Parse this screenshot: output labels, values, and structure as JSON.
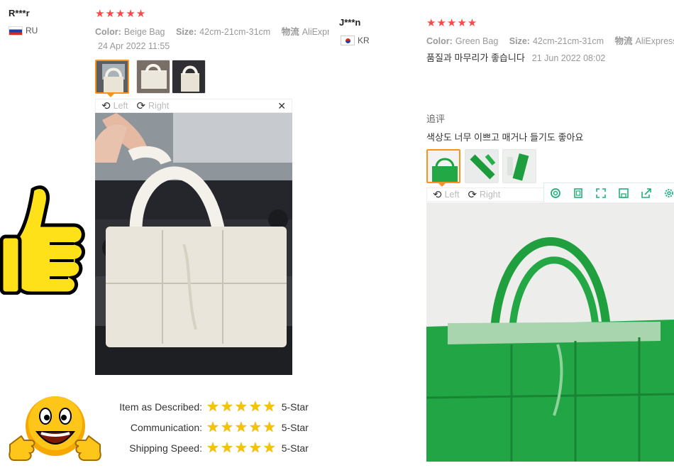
{
  "review1": {
    "user": "R***r",
    "country_code": "RU",
    "stars": "★★★★★",
    "color_label": "Color:",
    "color_value": "Beige Bag",
    "size_label": "Size:",
    "size_value": "42cm-21cm-31cm",
    "logistics_label": "物流",
    "logistics_value": "AliExpr",
    "date": "24 Apr 2022 11:55",
    "rotate_left": "Left",
    "rotate_right": "Right",
    "close": "✕"
  },
  "review2": {
    "user": "J***n",
    "country_code": "KR",
    "stars": "★★★★★",
    "color_label": "Color:",
    "color_value": "Green Bag",
    "size_label": "Size:",
    "size_value": "42cm-21cm-31cm",
    "logistics_label": "物流",
    "logistics_value": "AliExpress",
    "text": "품질과 마무리가 좋습니다",
    "date": "21 Jun 2022 08:02",
    "followup_label": "追评",
    "followup_text": "색상도 너무 이쁘고 매거나 들기도 좋아요",
    "rotate_left": "Left",
    "rotate_right": "Right"
  },
  "ratings": [
    {
      "label": "Item as Described:",
      "value": "5-Star"
    },
    {
      "label": "Communication:",
      "value": "5-Star"
    },
    {
      "label": "Shipping Speed:",
      "value": "5-Star"
    }
  ],
  "colors": {
    "accent_star": "#ff4747",
    "active_thumb": "#f7941d",
    "tool_green": "#1fb07a",
    "rating_star": "#f5c400"
  }
}
